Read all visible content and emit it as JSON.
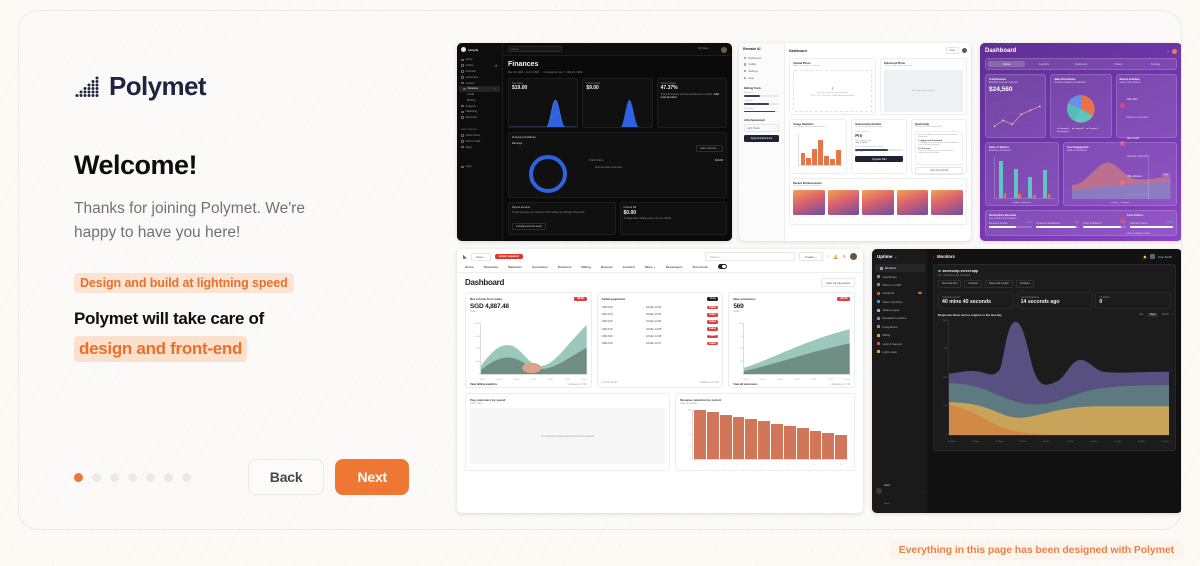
{
  "brand": {
    "name": "Polymet",
    "logo_icon": "polymet-dots-logo",
    "accent": "#ee7733",
    "navy": "#1e2442"
  },
  "headline": "Welcome!",
  "subtitle": "Thanks for joining Polymet. We're happy to have you here!",
  "tagline": "Design and build at lightning speed",
  "promise_line1": "Polymet will take care of",
  "promise_highlight": "design and front-end",
  "controls": {
    "back_label": "Back",
    "next_label": "Next",
    "total_dots": 7,
    "active_dot": 1
  },
  "footnote": "Everything in this page has been designed with Polymet",
  "collage": {
    "shot1": {
      "app": "shopify",
      "title": "Finances",
      "daterange": "Mar 24, 2024 - Jun 9, 2024",
      "compare": "compared to Jan 7 - Mar 24, 2024",
      "search_placeholder": "Search",
      "user": "My Store",
      "nav": [
        "Home",
        "Orders",
        "Products",
        "Customers",
        "Content",
        "Finances",
        "Analytics",
        "Marketing",
        "Discounts"
      ],
      "subnav": [
        "Credit",
        "Bill Pay"
      ],
      "nav_group_label": "Sales channels",
      "nav_group": [
        "Online Store",
        "Point of Sale",
        "Shop"
      ],
      "nav_apps": "Apps",
      "orders_badge": "2",
      "stats": [
        {
          "label": "Net sales",
          "value": "$19.00"
        },
        {
          "label": "Gross profit",
          "value": "$9.00"
        },
        {
          "label": "Gross margin",
          "value": "47.37%"
        }
      ],
      "gross_note": "Track all finance and fees/products on orders.",
      "gross_link": "Add cost per item",
      "breakdown_title": "Finances breakdown",
      "earnings_label": "Earnings",
      "sales_channels_btn": "Sales channels",
      "draft_orders": "Draft Orders",
      "draft_value": "$19.00",
      "view_all": "View all sales channels",
      "payout_title": "Payout account",
      "payout_text": "To get payouts, you need to finish setting up Shopify Payments",
      "payout_btn": "Complete account setup",
      "bill_title": "Current bill",
      "bill_value": "$0.00",
      "bill_note": "13 days left in billing cycle (Jun 10, 2024)"
    },
    "shot2": {
      "app": "Remade AI",
      "title": "Dashboard",
      "save_btn": "Save",
      "nav": [
        "Dashboard",
        "Gallery",
        "Settings",
        "Help"
      ],
      "tools_label": "Editing Tools",
      "tools": [
        "Brightness",
        "Contrast",
        "Saturation"
      ],
      "ai_label": "AI Enhancement",
      "ai_select": "Light Shade",
      "ai_button": "Apply Enhancement",
      "upload_title": "Upload Photo",
      "upload_sub": "Select an image to enhance",
      "upload_cta": "Click to upload or drag and drop",
      "upload_hint": "PNG, JPG, GIF up to 10MB (Recommended)",
      "enhanced_title": "Enhanced Photo",
      "enhanced_sub": "View your AI enhanced result",
      "enhanced_empty": "No image enhanced yet",
      "usage_title": "Usage Statistics",
      "usage_sub": "Your photo enhancement activity",
      "usage_categories": [
        "Mon",
        "Tue",
        "Wed",
        "Thu",
        "Fri",
        "Sat",
        "Sun"
      ],
      "usage_values": [
        38,
        22,
        52,
        82,
        30,
        20,
        48
      ],
      "sub_title": "Subscription Details",
      "sub_sub": "Your current plan and usage",
      "plan_label": "Current Plan",
      "plan_value": "Pro",
      "billing_label": "Next Billing Date",
      "billing_value": "July 1, 2023",
      "quota_label": "Photos Enhanced This Month",
      "quota_value": "68 / 100",
      "quota_pct": 68,
      "upgrade_btn": "Upgrade Plan",
      "help_title": "Quick Help",
      "help_sub": "Get started with Remade AI",
      "help_intro": "Select an AI enhancement style from the dropdown.",
      "help_items": [
        {
          "n": "1. Apply and Download",
          "d": "Click Apply Enhancement, then download your enhanced image."
        },
        {
          "n": "2. Fine-tune",
          "d": "Use the editing tools to make further adjustments if needed."
        }
      ],
      "help_btn": "View Full Tutorial",
      "recent_title": "Recent Enhancements",
      "recent_sub": "Your latest enhanced photos"
    },
    "shot3": {
      "title": "Dashboard",
      "tabs": [
        "Home",
        "Analytics",
        "Customers",
        "Orders",
        "Settings"
      ],
      "revenue_title": "Total Revenue",
      "revenue_sub": "Monthly revenue overview",
      "revenue_value": "$24,560",
      "revenue_x": [
        "Jan",
        "Feb",
        "Mar",
        "Apr",
        "May",
        "Jun"
      ],
      "revenue_y": [
        800,
        1100,
        900,
        1400,
        1650,
        2000
      ],
      "pie_title": "Sales Distribution",
      "pie_sub": "Product category breakdown",
      "pie_legend": [
        "Category A",
        "Category B",
        "Category C",
        "Category D"
      ],
      "pie_values": [
        35,
        28,
        22,
        15
      ],
      "activity_title": "Recent Activities",
      "activity_sub": "Latest user actions",
      "activities": [
        {
          "name": "John Doe",
          "text": "Placed a new order"
        },
        {
          "name": "Jane Smith",
          "text": "Updated profile info"
        },
        {
          "name": "Mike Johnson",
          "text": "Requested a refund"
        },
        {
          "name": "Sarah Williams",
          "text": "Left a product review"
        }
      ],
      "bar_title": "Sales vs Returns",
      "bar_sub": "Monthly comparison",
      "bar_categories": [
        "Product A",
        "Product B",
        "Product C",
        "Product D"
      ],
      "bar_sales": [
        5000,
        4000,
        2800,
        3800
      ],
      "bar_returns": [
        700,
        600,
        400,
        500
      ],
      "bar_legend": [
        "Sales",
        "Returns"
      ],
      "area_title": "User Engagement",
      "area_sub": "Daily vs Sessions",
      "area_legend": [
        "Users",
        "Sessions"
      ],
      "perf_title": "Performance Overview",
      "perf_sub": "Key metrics and updates",
      "perf_metrics": [
        {
          "label": "Revenue Growth",
          "value": "+12.4%"
        },
        {
          "label": "Customer Satisfaction",
          "value": "94%"
        },
        {
          "label": "Order Fulfillment",
          "value": "88%"
        },
        {
          "label": "Website Uptime",
          "value": "99.9%"
        }
      ]
    },
    "shot4": {
      "account": "Jane",
      "alert": "Action required",
      "search_placeholder": "Search...",
      "create_btn": "Create",
      "nav": [
        "Home",
        "Payments",
        "Balances",
        "Customers",
        "Products",
        "Billing",
        "Reports",
        "Connect",
        "More",
        "Developers"
      ],
      "testmode_label": "Test mode",
      "title": "Dashboard",
      "view_payments": "View all payments",
      "net_volume": {
        "title": "Net volume from sales",
        "badge": "-38.8%",
        "value": "SGD 4,887.48",
        "period": "Today",
        "x": [
          "00:00",
          "04:00",
          "08:00",
          "12:00",
          "16:00",
          "20:00",
          "00:00"
        ],
        "ymax": 8000,
        "footer": "View billing analytics",
        "updated": "Updated at 17:49"
      },
      "failed": {
        "title": "Failed payments",
        "badge": "Today",
        "rows": [
          {
            "amount": "USD 6.00",
            "time": "24 Mar, 16:02",
            "status": "Failed"
          },
          {
            "amount": "USD 6.00",
            "time": "24 Mar, 15:03",
            "status": "Failed"
          },
          {
            "amount": "USD 6.00",
            "time": "24 Mar, 14:04",
            "status": "Failed"
          },
          {
            "amount": "USD 6.00",
            "time": "24 Mar, 13:05",
            "status": "Failed"
          },
          {
            "amount": "USD 6.00",
            "time": "24 Mar, 12:06",
            "status": "Failed"
          },
          {
            "amount": "USD 6.00",
            "time": "24 Mar, 11:07",
            "status": "Failed"
          }
        ],
        "results": "6 of 20 results",
        "updated": "Updated at 17:49"
      },
      "customers": {
        "title": "New customers",
        "badge": "+28.9%",
        "value": "569",
        "period": "Today",
        "x": [
          "00:00",
          "04:00",
          "08:00",
          "12:00",
          "16:00",
          "20:00",
          "00:00"
        ],
        "ymax": 1000,
        "footer": "View all customers",
        "updated": "Updated at 17:49"
      },
      "top_customers": {
        "title": "Top customers by spend",
        "sub": "Last 7 days",
        "empty": "No customers with payments in this time period"
      },
      "cohort": {
        "title": "Revenue retention by cohort",
        "sub": "Last 12 months",
        "categories": [
          "1",
          "2",
          "3",
          "4",
          "5",
          "6",
          "7",
          "8",
          "9",
          "10",
          "11",
          "12"
        ],
        "values": [
          100,
          95,
          90,
          86,
          82,
          77,
          72,
          67,
          63,
          58,
          53,
          48
        ],
        "ymax": 100
      }
    },
    "shot5": {
      "app": "Uptime",
      "breadcrumb": "Monitors",
      "user": "Jane Smith",
      "nav": [
        {
          "label": "Monitors",
          "color": "#8aa0c9",
          "badge": ""
        },
        {
          "label": "Heartbeats",
          "color": "#7f8ea8",
          "badge": ""
        },
        {
          "label": "Who's on-call?",
          "color": "#7f8ea8",
          "badge": ""
        },
        {
          "label": "Incidents",
          "color": "#d9534f",
          "badge": "2"
        },
        {
          "label": "Team members",
          "color": "#5a8ec9",
          "badge": ""
        },
        {
          "label": "Status pages",
          "color": "#a8aeb8",
          "badge": ""
        },
        {
          "label": "Escalation policies",
          "color": "#4f9dd8",
          "badge": ""
        },
        {
          "label": "Integrations",
          "color": "#8b8f98",
          "badge": ""
        },
        {
          "label": "Billing",
          "color": "#e0a42c",
          "badge": ""
        },
        {
          "label": "Help & Support",
          "color": "#d9534f",
          "badge": ""
        },
        {
          "label": "Light mode",
          "color": "#e0a42c",
          "badge": ""
        }
      ],
      "footer_user": "Team",
      "footer_sub": "Admin",
      "monitor_url": "acmecorp.vercel.app",
      "monitor_status": "Up · Checked every 3 minutes",
      "actions": [
        "Send test alert",
        "Incidents",
        "Pause this monitor",
        "Configure"
      ],
      "stats": [
        {
          "label": "Currently up for",
          "value": "40 mins 40 seconds"
        },
        {
          "label": "Last checked at",
          "value": "14 seconds ago"
        },
        {
          "label": "Incidents",
          "value": "0"
        }
      ],
      "chart_title": "Response times across regions in the last day",
      "range_tabs": [
        "Day",
        "Week",
        "Month"
      ],
      "range_active": "Week",
      "x_labels": [
        "04:18pm",
        "07:18pm",
        "10:18pm",
        "01:18am",
        "04:18am",
        "07:18am",
        "10:18am",
        "01:18pm",
        "04:18pm",
        "07:18pm"
      ],
      "y_labels": [
        "1000",
        "750",
        "500",
        "250",
        "0"
      ]
    }
  },
  "chart_data": [
    {
      "type": "bar",
      "title": "Usage Statistics",
      "categories": [
        "Mon",
        "Tue",
        "Wed",
        "Thu",
        "Fri",
        "Sat",
        "Sun"
      ],
      "values": [
        38,
        22,
        52,
        82,
        30,
        20,
        48
      ],
      "ylim": [
        0,
        100
      ]
    },
    {
      "type": "line",
      "title": "Total Revenue",
      "categories": [
        "Jan",
        "Feb",
        "Mar",
        "Apr",
        "May",
        "Jun"
      ],
      "values": [
        800,
        1100,
        900,
        1400,
        1650,
        2000
      ],
      "ylim": [
        0,
        2500
      ]
    },
    {
      "type": "pie",
      "title": "Sales Distribution",
      "categories": [
        "Category A",
        "Category B",
        "Category C",
        "Category D"
      ],
      "values": [
        35,
        28,
        22,
        15
      ]
    },
    {
      "type": "bar",
      "title": "Sales vs Returns",
      "categories": [
        "Product A",
        "Product B",
        "Product C",
        "Product D"
      ],
      "series": [
        {
          "name": "Sales",
          "values": [
            5000,
            4000,
            2800,
            3800
          ]
        },
        {
          "name": "Returns",
          "values": [
            700,
            600,
            400,
            500
          ]
        }
      ],
      "ylim": [
        0,
        6000
      ]
    },
    {
      "type": "bar",
      "title": "Revenue retention by cohort",
      "categories": [
        "1",
        "2",
        "3",
        "4",
        "5",
        "6",
        "7",
        "8",
        "9",
        "10",
        "11",
        "12"
      ],
      "values": [
        100,
        95,
        90,
        86,
        82,
        77,
        72,
        67,
        63,
        58,
        53,
        48
      ],
      "ylim": [
        0,
        100
      ]
    }
  ]
}
